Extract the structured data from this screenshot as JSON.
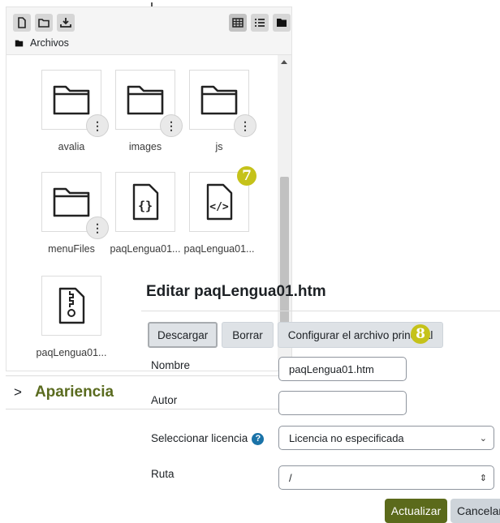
{
  "file_manager": {
    "toolbar": {
      "left_icons": [
        "new-file-icon",
        "new-folder-icon",
        "download-icon"
      ],
      "right_icons": [
        "grid-view-icon",
        "list-view-icon",
        "tree-view-icon"
      ]
    },
    "path": {
      "label": "Archivos",
      "icon": "folder-icon"
    },
    "files": [
      {
        "name": "avalia",
        "icon": "folder-icon",
        "has_menu": true
      },
      {
        "name": "images",
        "icon": "folder-icon",
        "has_menu": true
      },
      {
        "name": "js",
        "icon": "folder-icon",
        "has_menu": true
      },
      {
        "name": "menuFiles",
        "icon": "folder-icon",
        "has_menu": true
      },
      {
        "name": "paqLengua01...",
        "icon": "json-file-icon",
        "has_menu": false
      },
      {
        "name": "paqLengua01...",
        "icon": "html-file-icon",
        "has_menu": false
      },
      {
        "name": "paqLengua01...",
        "icon": "zip-file-icon",
        "has_menu": false
      }
    ],
    "badge_step_7": "7"
  },
  "apariencia": {
    "chevron": ">",
    "title": "Apariencia"
  },
  "dialog": {
    "title": "Editar paqLengua01.htm",
    "buttons": {
      "download": "Descargar",
      "delete": "Borrar",
      "set_main": "Configurar el archivo principal"
    },
    "badge_step_8": "8",
    "fields": {
      "name_label": "Nombre",
      "name_value": "paqLengua01.htm",
      "author_label": "Autor",
      "author_value": "",
      "license_label": "Seleccionar licencia",
      "license_value": "Licencia no especificada",
      "path_label": "Ruta",
      "path_value": "/"
    },
    "actions": {
      "update": "Actualizar",
      "cancel": "Cancelar"
    }
  }
}
